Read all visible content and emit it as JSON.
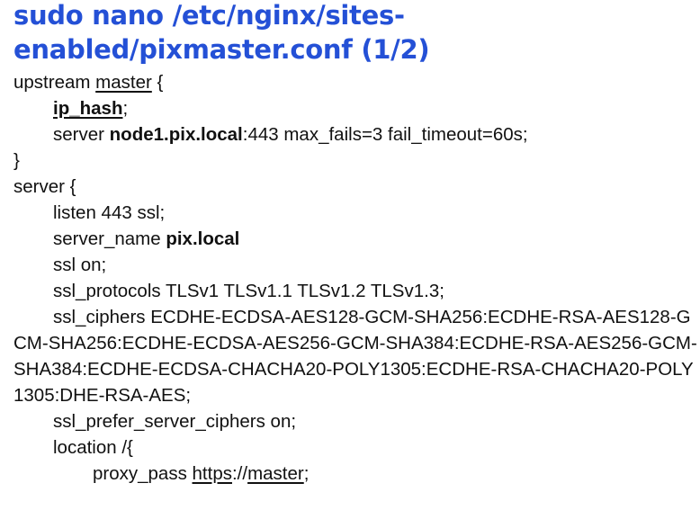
{
  "title": "sudo nano /etc/nginx/sites-enabled/pixmaster.conf (1/2)",
  "code": {
    "l01": {
      "a": "upstream ",
      "b": "master",
      "c": " {"
    },
    "l02": {
      "a": "ip_hash",
      "b": ";"
    },
    "l03": {
      "a": "server ",
      "b": "node1.pix.local",
      "c": ":443 max_fails=3 fail_timeout=60s;"
    },
    "l04": "}",
    "l05": "server {",
    "l06": "listen 443 ssl;",
    "l07": {
      "a": "server_name ",
      "b": "pix.local"
    },
    "l08": "ssl on;",
    "l09": "ssl_protocols TLSv1 TLSv1.1 TLSv1.2 TLSv1.3;",
    "l10": "ssl_ciphers ECDHE-ECDSA-AES128-GCM-SHA256:ECDHE-RSA-AES128-GCM-SHA256:ECDHE-ECDSA-AES256-GCM-SHA384:ECDHE-RSA-AES256-GCM-SHA384:ECDHE-ECDSA-CHACHA20-POLY1305:ECDHE-RSA-CHACHA20-POLY1305:DHE-RSA-AES;",
    "l11": "ssl_prefer_server_ciphers on;",
    "l12": "location /{",
    "l13": {
      "a": "proxy_pass ",
      "b": "https",
      "c": "://",
      "d": "master",
      "e": ";"
    }
  },
  "colors": {
    "title": "#2450d6",
    "text": "#111111",
    "background": "#ffffff"
  }
}
